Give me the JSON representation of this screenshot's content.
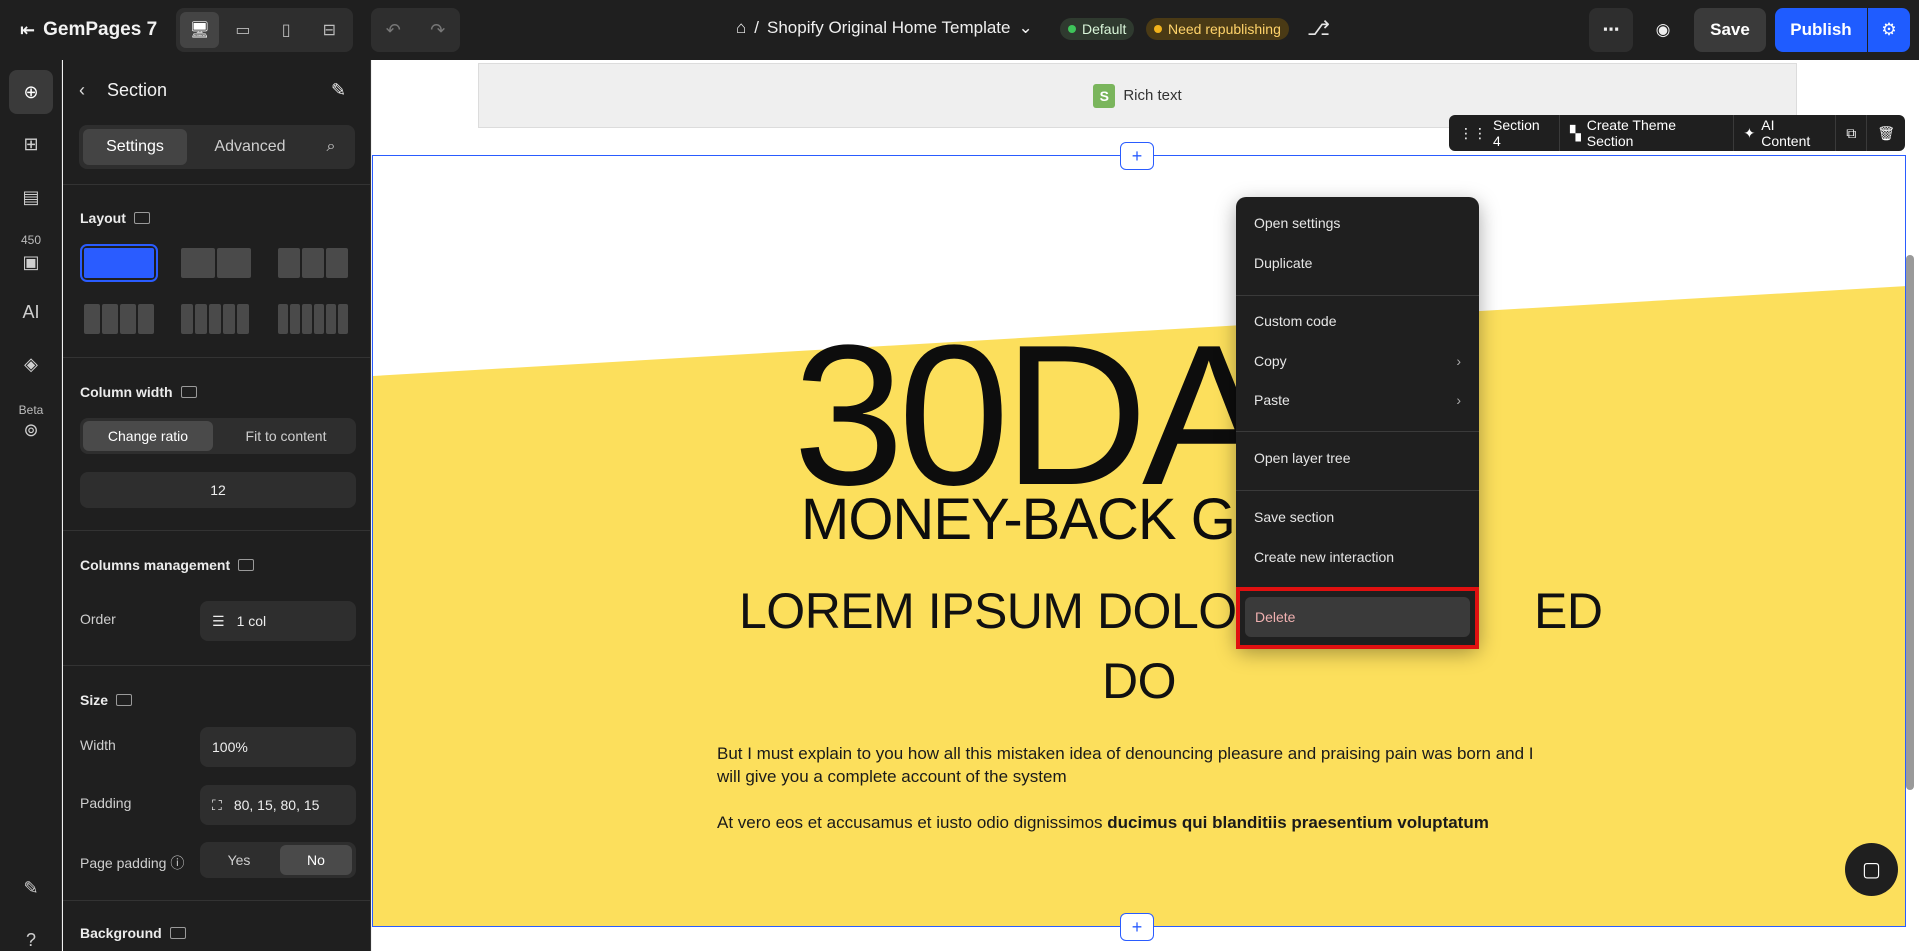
{
  "topbar": {
    "app_name": "GemPages 7",
    "breadcrumb_prefix": "/",
    "page_title": "Shopify Original Home Template",
    "badge_default": "Default",
    "badge_republish": "Need republishing",
    "save_label": "Save",
    "publish_label": "Publish"
  },
  "rail": {
    "badge_count": "450",
    "beta_label": "Beta"
  },
  "panel": {
    "title": "Section",
    "tabs": [
      "Settings",
      "Advanced"
    ],
    "layout_label": "Layout",
    "column_width_label": "Column width",
    "column_width_options": [
      "Change ratio",
      "Fit to content"
    ],
    "column_width_value": "12",
    "columns_management_label": "Columns management",
    "order_label": "Order",
    "order_value": "1 col",
    "size_label": "Size",
    "width_label": "Width",
    "width_value": "100%",
    "padding_label": "Padding",
    "padding_value": "80, 15, 80, 15",
    "page_padding_label": "Page padding",
    "page_padding_options": [
      "Yes",
      "No"
    ],
    "background_label": "Background"
  },
  "canvas": {
    "rich_text_label": "Rich text",
    "big_heading": "30DA",
    "subheading": "MONEY-BACK GU",
    "lorem_line1_left": "LOREM IPSUM DOLOR",
    "lorem_line1_right": "ED",
    "lorem_line2": "DO",
    "para1": "But I must explain to you how all this mistaken idea of denouncing pleasure and praising pain was born and I will give you a complete account of the system",
    "para2_normal": "At vero eos et accusamus et iusto odio dignissimos ",
    "para2_bold": "ducimus qui blanditiis praesentium voluptatum",
    "accent_yellow": "#fcdf5c"
  },
  "section_toolbar": {
    "section_label": "Section 4",
    "create_theme_label": "Create Theme Section",
    "ai_label": "AI Content"
  },
  "context_menu": {
    "items": [
      "Open settings",
      "Duplicate",
      "Custom code",
      "Copy",
      "Paste",
      "Open layer tree",
      "Save section",
      "Create new interaction",
      "Delete"
    ]
  }
}
